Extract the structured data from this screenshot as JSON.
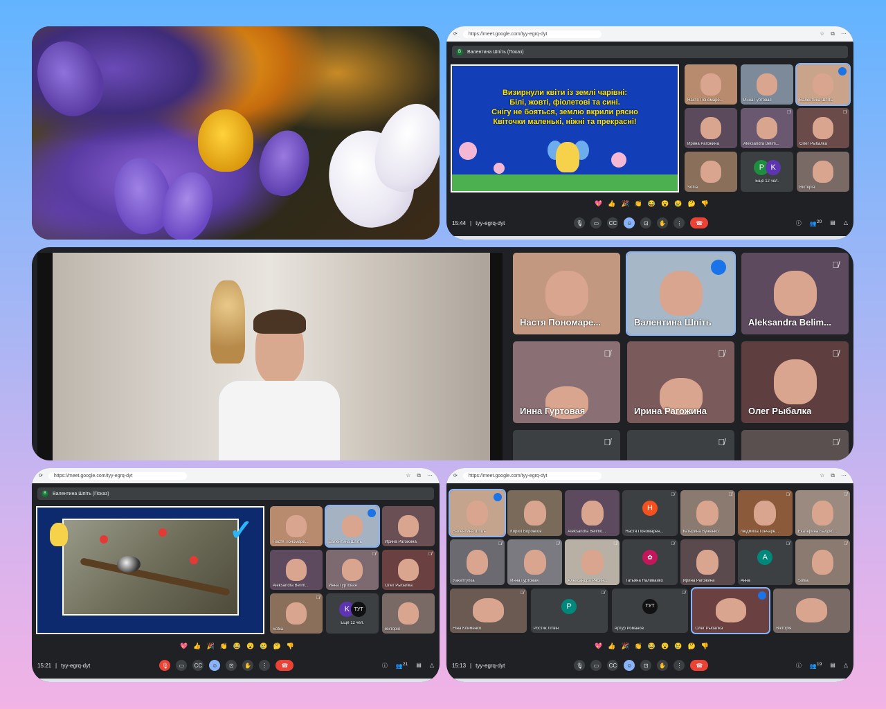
{
  "panel2": {
    "url": "https://meet.google.com/tyy-egrq-dyt",
    "presenter": "Валентина Шпіть (Показ)",
    "poem": [
      "Визирнули квіти із землі чарівні:",
      "Білі, жовті, фіолетові та сині.",
      "Снігу не бояться, землю вкрили рясно",
      "Квіточки маленькі, ніжні та прекрасні!"
    ],
    "tiles": [
      "Настя Пономаре...",
      "Инна Гуртовая",
      "Валентина Шпіть",
      "Ирина Рагожина",
      "Aleksandra Belim...",
      "Олег Рыбалка",
      "Sofiia",
      "Ещё 12 чел.",
      "Вікторія"
    ],
    "time": "15:44",
    "code": "tyy-egrq-dyt",
    "badge": "20"
  },
  "panel3": {
    "tiles": [
      "Настя Пономаре...",
      "Валентина Шпіть",
      "Aleksandra Belim...",
      "Инна Гуртовая",
      "Ирина Рагожина",
      "Олег Рыбалка"
    ]
  },
  "panel4": {
    "url": "https://meet.google.com/tyy-egrq-dyt",
    "presenter": "Валентина Шпіть (Показ)",
    "tiles": [
      "Настя Пономаре...",
      "Валентина Шпіть",
      "Ирина Рагожина",
      "Aleksandra Belim...",
      "Инна Гуртовая",
      "Олег Рыбалка",
      "Sofiia",
      "Ещё 12 чел.",
      "Вікторія"
    ],
    "time": "15:21",
    "code": "tyy-egrq-dyt",
    "badge": "21"
  },
  "panel5": {
    "url": "https://meet.google.com/tyy-egrq-dyt",
    "row1": [
      "Валентина Шпіть",
      "Кирил Воронков",
      "Aleksandra Belimo...",
      "Настя Пономарен...",
      "Катерина Вуженко",
      "Людмила Гончаре...",
      "Екатерина Балдко..."
    ],
    "row2": [
      "Уакелтупка",
      "Инна Гуртовая",
      "Александра Рябин...",
      "Татьяна Наливайко",
      "Ирина Рагожина",
      "Анна",
      "Sofiia"
    ],
    "row3": [
      "Ніна Клименко",
      "Ростик Літвін",
      "Артур Романов",
      "Олег Рыбалка",
      "Вікторія"
    ],
    "avatar_h": "Н",
    "avatar_a": "A",
    "avatar_p": "P",
    "time": "15:13",
    "code": "tyy-egrq-dyt",
    "badge": "19"
  },
  "reactions": [
    "💖",
    "👍",
    "🎉",
    "👏",
    "😂",
    "😮",
    "😢",
    "🤔",
    "👎"
  ],
  "colors": {
    "meet_dark": "#202124",
    "end_call": "#ea4335",
    "accent": "#8ab4f8"
  }
}
